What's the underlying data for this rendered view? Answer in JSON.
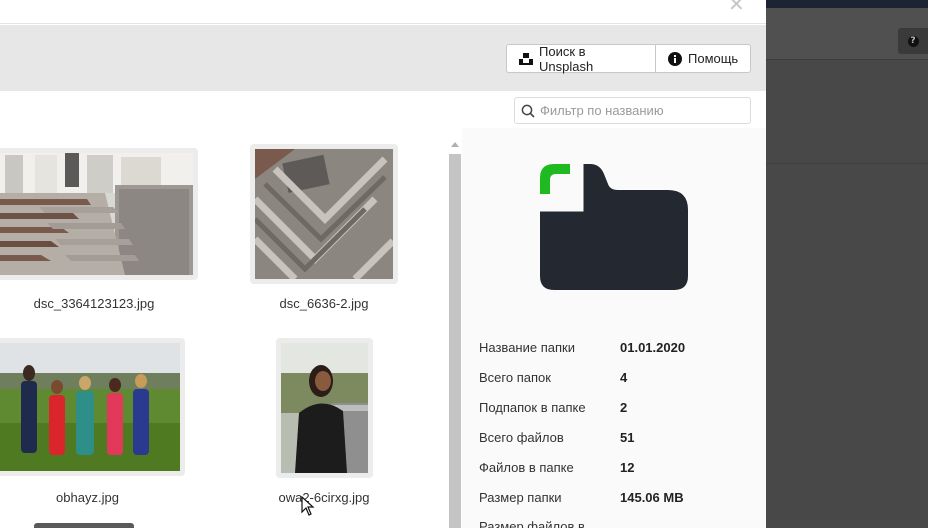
{
  "toolbar": {
    "unsplash_label": "Поиск в Unsplash",
    "help_label": "Помощь"
  },
  "close_label": "✕",
  "filter": {
    "placeholder": "Фильтр по названию"
  },
  "files": [
    {
      "name": "dsc_3364123123.jpg"
    },
    {
      "name": "dsc_6636-2.jpg"
    },
    {
      "name": "obhayz.jpg"
    },
    {
      "name": "owa2-6cirxg.jpg"
    }
  ],
  "folder_info": {
    "rows": [
      {
        "label": "Название папки",
        "value": "01.01.2020"
      },
      {
        "label": "Всего папок",
        "value": "4"
      },
      {
        "label": "Подпапок в папке",
        "value": "2"
      },
      {
        "label": "Всего файлов",
        "value": "51"
      },
      {
        "label": "Файлов в папке",
        "value": "12"
      },
      {
        "label": "Размер папки",
        "value": "145.06 MB"
      },
      {
        "label": "Размер файлов в",
        "value": ""
      }
    ]
  },
  "icons": {
    "unsplash": "unsplash-icon",
    "help": "info-icon",
    "search": "search-icon",
    "folder": "folder-icon",
    "close": "close-icon",
    "background_help": "question-icon"
  },
  "colors": {
    "folder_body": "#232831",
    "folder_accent": "#1fba1f",
    "toolbar_bg": "#e7e7e7",
    "scroll_thumb": "#c4c4c4"
  },
  "background_app": {
    "help_glyph": "?"
  }
}
